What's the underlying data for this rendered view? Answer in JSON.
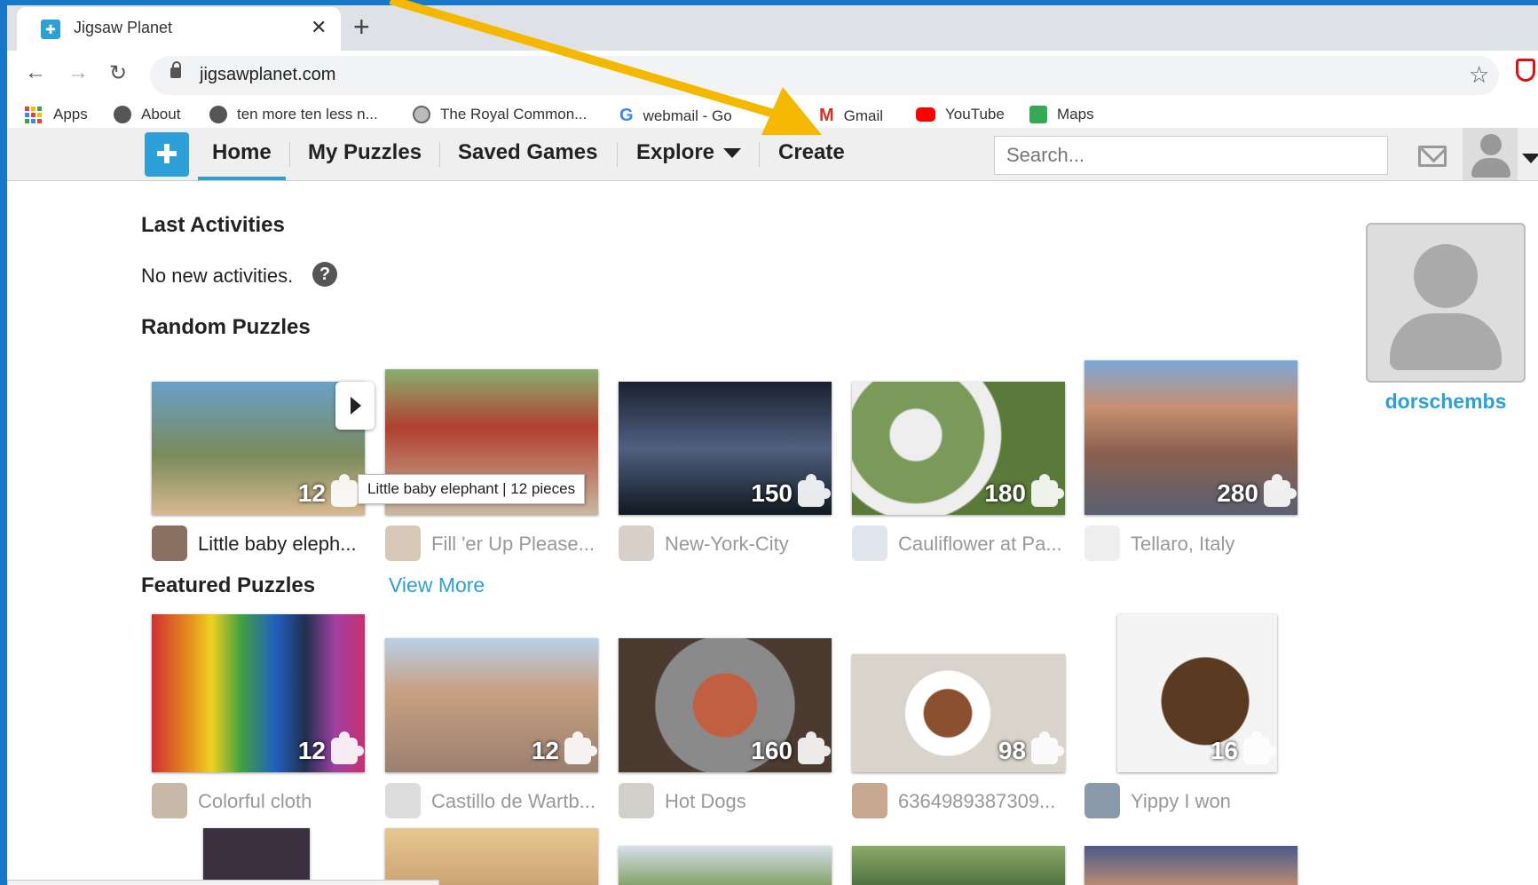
{
  "browser": {
    "tab_title": "Jigsaw Planet",
    "url": "jigsawplanet.com",
    "bookmarks": [
      "Apps",
      "About",
      "ten more ten less n...",
      "The Royal Common...",
      "webmail - Go",
      "Gmail",
      "YouTube",
      "Maps"
    ]
  },
  "site_nav": {
    "items": [
      "Home",
      "My Puzzles",
      "Saved Games",
      "Explore",
      "Create"
    ],
    "search_placeholder": "Search..."
  },
  "sections": {
    "last_activities": "Last Activities",
    "no_activities": "No new activities.",
    "random_puzzles": "Random Puzzles",
    "featured_puzzles": "Featured Puzzles",
    "view_more": "View More"
  },
  "random_puzzles": [
    {
      "title": "Little baby eleph...",
      "pieces": "12",
      "color": "#8a7a5a"
    },
    {
      "title": "Fill 'er Up Please...",
      "pieces": "",
      "color": "#7b9a5a"
    },
    {
      "title": "New-York-City",
      "pieces": "150",
      "color": "#2a3040"
    },
    {
      "title": "Cauliflower at Pa...",
      "pieces": "180",
      "color": "#6f8a4a"
    },
    {
      "title": "Tellaro, Italy",
      "pieces": "280",
      "color": "#9a8070"
    }
  ],
  "featured_puzzles": [
    {
      "title": "Colorful cloth",
      "pieces": "12",
      "color": "#c8506a"
    },
    {
      "title": "Castillo de Wartb...",
      "pieces": "12",
      "color": "#a08a6a"
    },
    {
      "title": "Hot Dogs",
      "pieces": "160",
      "color": "#7a5040"
    },
    {
      "title": "6364989387309...",
      "pieces": "98",
      "color": "#c8c0b0"
    },
    {
      "title": "Yippy I won",
      "pieces": "16",
      "color": "#6a4a30"
    }
  ],
  "tooltip": "Little baby elephant | 12 pieces",
  "profile": {
    "username": "dorschembs"
  },
  "colors": {
    "accent": "#2d9fd9",
    "annotation_arrow": "#f5b800"
  }
}
